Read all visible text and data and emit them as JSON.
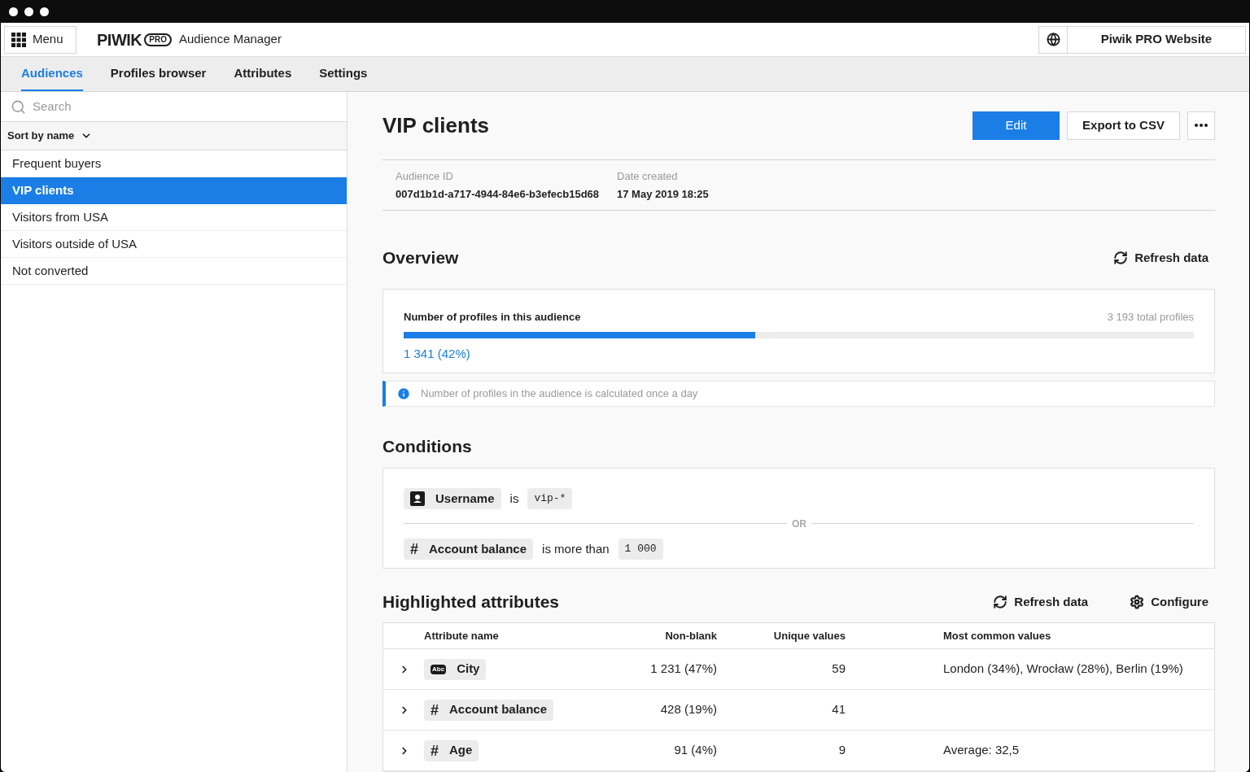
{
  "header": {
    "menu_label": "Menu",
    "logo_main": "PIWIK",
    "logo_badge": "PRO",
    "app_name": "Audience Manager",
    "website": "Piwik PRO Website"
  },
  "tabs": [
    {
      "label": "Audiences",
      "selected": true
    },
    {
      "label": "Profiles browser",
      "selected": false
    },
    {
      "label": "Attributes",
      "selected": false
    },
    {
      "label": "Settings",
      "selected": false
    }
  ],
  "sidebar": {
    "search": {
      "placeholder": "Search"
    },
    "sort_label": "Sort by name",
    "items": [
      {
        "label": "Frequent buyers",
        "selected": false
      },
      {
        "label": "VIP clients",
        "selected": true
      },
      {
        "label": "Visitors from USA",
        "selected": false
      },
      {
        "label": "Visitors outside of USA",
        "selected": false
      },
      {
        "label": "Not converted",
        "selected": false
      }
    ]
  },
  "detail": {
    "title": "VIP clients",
    "buttons": {
      "edit": "Edit",
      "export": "Export to CSV"
    },
    "meta": [
      {
        "label": "Audience ID",
        "value": "007d1b1d-a717-4944-84e6-b3efecb15d68"
      },
      {
        "label": "Date created",
        "value": "17 May 2019 18:25"
      }
    ],
    "overview": {
      "title": "Overview",
      "refresh": "Refresh data",
      "card_title": "Number of profiles in this audience",
      "total": "3 193 total profiles",
      "level": 0.445,
      "count": "1 341 (42%)",
      "info": "Number of profiles in the audience is calculated once a day"
    },
    "conditions": {
      "title": "Conditions",
      "separator": "OR",
      "rows": [
        {
          "kind": "identity",
          "attribute": "Username",
          "operator": "is",
          "value": "vip-*"
        },
        {
          "kind": "number",
          "icon_text": "#",
          "attribute": "Account balance",
          "operator": "is more than",
          "value": "1 000"
        }
      ]
    },
    "highlighted": {
      "title": "Highlighted attributes",
      "refresh": "Refresh data",
      "configure": "Configure",
      "columns": [
        "Attribute name",
        "Non-blank",
        "Unique values",
        "Most common values"
      ],
      "rows": [
        {
          "kind": "text",
          "icon_text": "Abc",
          "name": "City",
          "non_blank": "1 231 (47%)",
          "unique": "59",
          "common": "London (34%), Wrocław (28%), Berlin (19%)"
        },
        {
          "kind": "number",
          "icon_text": "#",
          "name": "Account balance",
          "non_blank": "428 (19%)",
          "unique": "41"
        },
        {
          "kind": "number",
          "icon_text": "#",
          "name": "Age",
          "non_blank": "91 (4%)",
          "unique": "9",
          "common": "Average: 32,5"
        }
      ]
    }
  }
}
